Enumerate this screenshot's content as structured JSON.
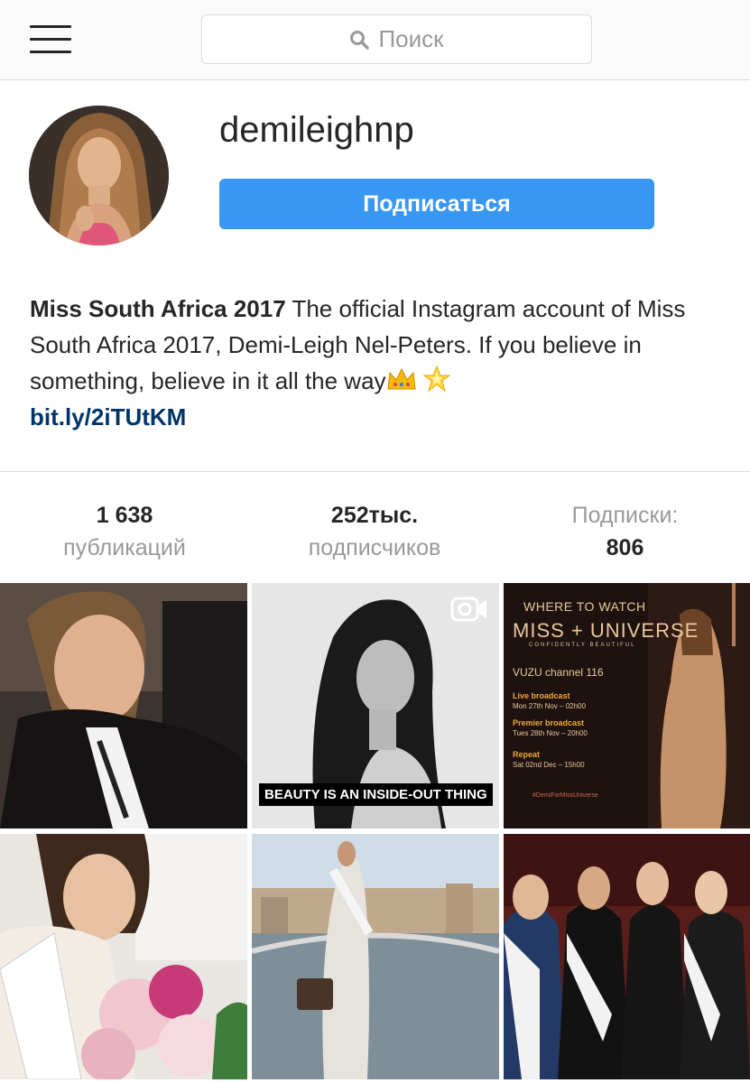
{
  "topbar": {
    "menu_icon": "hamburger-menu-icon",
    "search": {
      "placeholder": "Поиск",
      "icon": "search-icon"
    }
  },
  "profile": {
    "username": "demileighnp",
    "follow_label": "Подписаться",
    "bio": {
      "name": "Miss South Africa 2017",
      "text": " The official Instagram account of Miss South Africa 2017, Demi-Leigh Nel-Peters. If you believe in something, believe in it all the way",
      "emojis": [
        "crown-emoji",
        "star-emoji"
      ],
      "link": "bit.ly/2iTUtKM"
    }
  },
  "stats": {
    "posts": {
      "value": "1 638",
      "label": "публикаций"
    },
    "followers": {
      "value": "252тыс.",
      "label": "подписчиков"
    },
    "following": {
      "label": "Подписки:",
      "value": "806"
    }
  },
  "grid": {
    "tile2": {
      "caption": "BEAUTY IS AN INSIDE-OUT THING",
      "icon": "video-icon"
    },
    "tile3": {
      "where": "WHERE TO WATCH",
      "brand": "MISS + UNIVERSE",
      "brand_sub": "CONFIDENTLY BEAUTIFUL",
      "channel": "VUZU channel 116",
      "live_h": "Live broadcast",
      "live_s": "Mon 27th Nov – 02h00",
      "premier_h": "Premier broadcast",
      "premier_s": "Tues 28th Nov – 20h00",
      "repeat_h": "Repeat",
      "repeat_s": "Sat 02nd Dec – 15h00",
      "hashtag": "#DemiForMissUniverse"
    }
  }
}
